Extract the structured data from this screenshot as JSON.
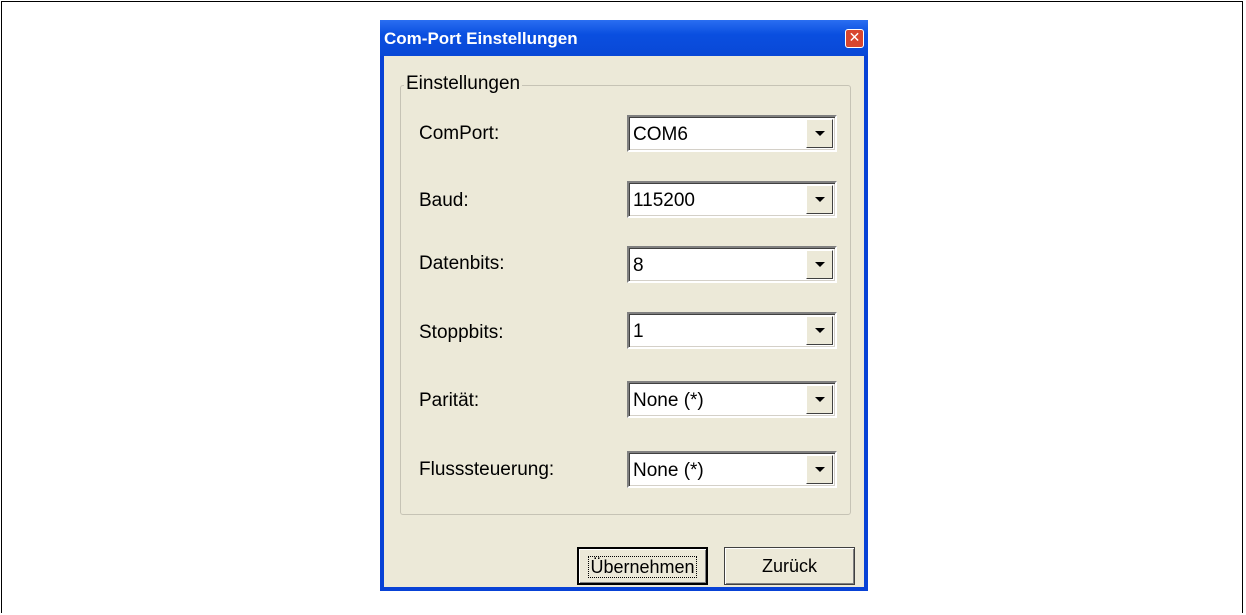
{
  "window": {
    "title": "Com-Port Einstellungen",
    "close_symbol": "✕"
  },
  "group": {
    "title": "Einstellungen"
  },
  "fields": [
    {
      "label": "ComPort:",
      "value": "COM6"
    },
    {
      "label": "Baud:",
      "value": "115200"
    },
    {
      "label": "Datenbits:",
      "value": "8"
    },
    {
      "label": "Stoppbits:",
      "value": "1"
    },
    {
      "label": "Parität:",
      "value": "None (*)"
    },
    {
      "label": "Flusssteuerung:",
      "value": "None (*)"
    }
  ],
  "buttons": {
    "apply": "Übernehmen",
    "back": "Zurück"
  },
  "colors": {
    "titlebar": "#0a4fe0",
    "client": "#ece9d8",
    "close": "#d8462f"
  }
}
